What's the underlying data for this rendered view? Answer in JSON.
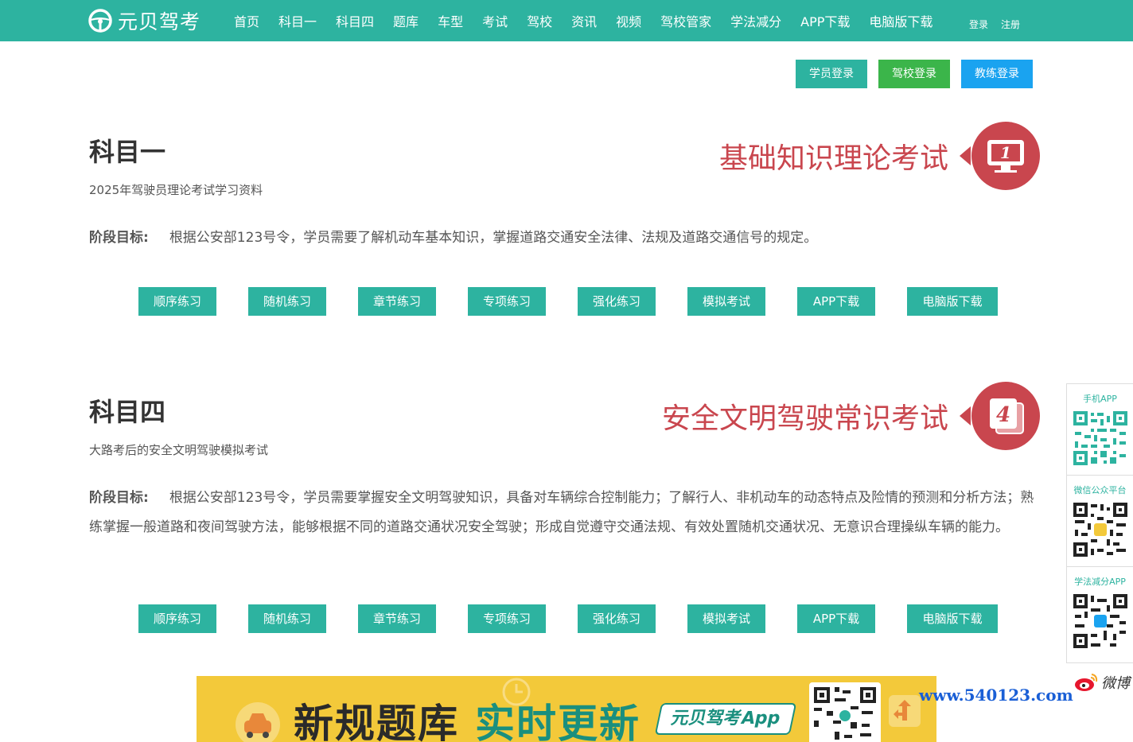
{
  "header": {
    "brand": "元贝驾考",
    "nav": [
      "首页",
      "科目一",
      "科目四",
      "题库",
      "车型",
      "考试",
      "驾校",
      "资讯",
      "视频",
      "驾校管家",
      "学法减分",
      "APP下载",
      "电脑版下载"
    ],
    "login": "登录",
    "register": "注册"
  },
  "login_buttons": [
    {
      "label": "学员登录",
      "color": "#2db3a0"
    },
    {
      "label": "驾校登录",
      "color": "#3bb54a"
    },
    {
      "label": "教练登录",
      "color": "#1aa3f0"
    }
  ],
  "sections": [
    {
      "title": "科目一",
      "subtitle": "2025年驾驶员理论考试学习资料",
      "slogan": "基础知识理论考试",
      "badge_number": "1",
      "goal_label": "阶段目标:",
      "goal_text": "根据公安部123号令，学员需要了解机动车基本知识，掌握道路交通安全法律、法规及道路交通信号的规定。",
      "buttons": [
        "顺序练习",
        "随机练习",
        "章节练习",
        "专项练习",
        "强化练习",
        "模拟考试",
        "APP下载",
        "电脑版下载"
      ]
    },
    {
      "title": "科目四",
      "subtitle": "大路考后的安全文明驾驶模拟考试",
      "slogan": "安全文明驾驶常识考试",
      "badge_number": "4",
      "goal_label": "阶段目标:",
      "goal_text": "根据公安部123号令，学员需要掌握安全文明驾驶知识，具备对车辆综合控制能力；了解行人、非机动车的动态特点及险情的预测和分析方法；熟练掌握一般道路和夜间驾驶方法，能够根据不同的道路交通状况安全驾驶；形成自觉遵守交通法规、有效处置随机交通状况、无意识合理操纵车辆的能力。",
      "buttons": [
        "顺序练习",
        "随机练习",
        "章节练习",
        "专项练习",
        "强化练习",
        "模拟考试",
        "APP下载",
        "电脑版下载"
      ]
    }
  ],
  "sidebar": {
    "items": [
      {
        "label": "手机APP",
        "icon": "qr-code-icon"
      },
      {
        "label": "微信公众平台",
        "icon": "qr-code-icon"
      },
      {
        "label": "学法减分APP",
        "icon": "qr-code-icon"
      }
    ],
    "weibo": "微博"
  },
  "banner": {
    "text1": "新规题库",
    "text2": "实时更新",
    "app_label": "元贝驾考App"
  },
  "watermark": "www.540123.com",
  "colors": {
    "primary": "#2db3a0",
    "accent_red": "#c9464e"
  }
}
